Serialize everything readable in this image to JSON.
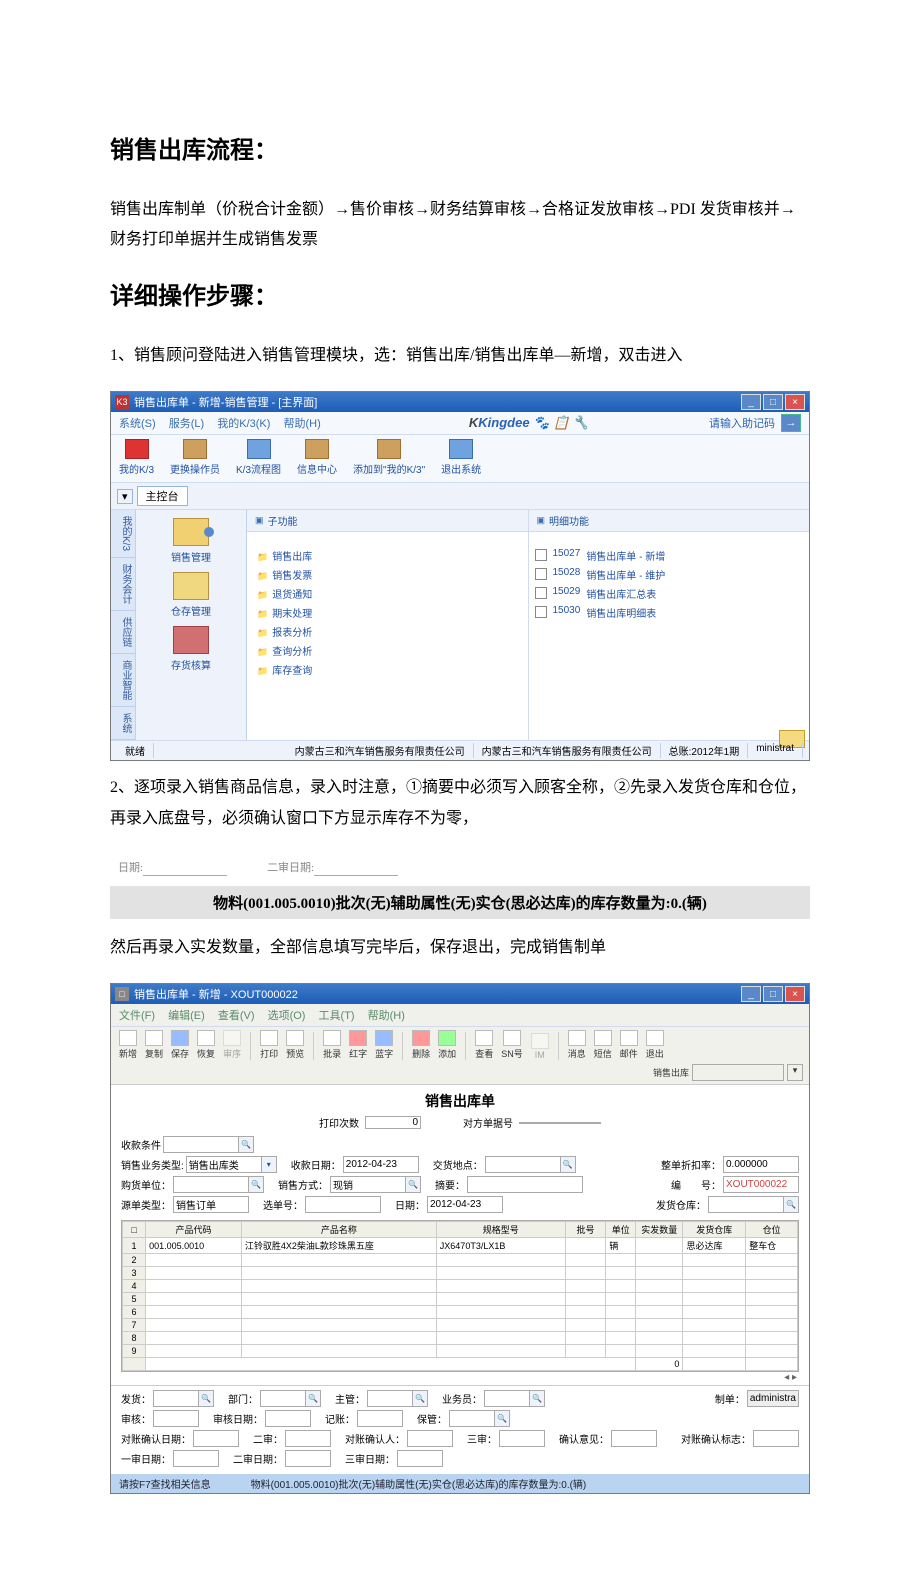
{
  "heading1": "销售出库流程：",
  "para1": "销售出库制单（价税合计金额）→售价审核→财务结算审核→合格证发放审核→PDI 发货审核并→财务打印单据并生成销售发票",
  "heading2": "详细操作步骤：",
  "para2": "1、销售顾问登陆进入销售管理模块，选：销售出库/销售出库单—新增，双击进入",
  "win1": {
    "title": "销售出库单 - 新增-销售管理 - [主界面]",
    "icon": "K3",
    "menu": [
      "系统(S)",
      "服务(L)",
      "我的K/3(K)",
      "帮助(H)"
    ],
    "kingdee": "Kingdee",
    "search_hint": "请输入助记码",
    "tb": [
      {
        "name": "mykc",
        "label": "我的K/3",
        "style": "tb-red"
      },
      {
        "name": "swop",
        "label": "更换操作员",
        "style": "tb-brown"
      },
      {
        "name": "flow",
        "label": "K/3流程图",
        "style": "tb-blue"
      },
      {
        "name": "info",
        "label": "信息中心",
        "style": "tb-brown"
      },
      {
        "name": "addmy",
        "label": "添加到\"我的K/3\"",
        "style": "tb-brown"
      },
      {
        "name": "exit",
        "label": "退出系统",
        "style": "tb-blue"
      }
    ],
    "tab_main": "主控台",
    "mods": [
      {
        "name": "sales",
        "label": "销售管理",
        "ic": "truck"
      },
      {
        "name": "stock",
        "label": "仓存管理",
        "ic": "house"
      },
      {
        "name": "check",
        "label": "存货核算",
        "ic": "stack"
      }
    ],
    "sidetabs": [
      "我的K/3",
      "财务会计",
      "供应链",
      "商业智能",
      "系统"
    ],
    "subfunc_title": "子功能",
    "subfunc": [
      "销售出库",
      "销售发票",
      "退货通知",
      "期末处理",
      "报表分析",
      "查询分析",
      "库存查询"
    ],
    "detail_title": "明细功能",
    "details": [
      {
        "code": "15027",
        "label": "销售出库单 - 新增"
      },
      {
        "code": "15028",
        "label": "销售出库单 - 维护"
      },
      {
        "code": "15029",
        "label": "销售出库汇总表"
      },
      {
        "code": "15030",
        "label": "销售出库明细表"
      }
    ],
    "status_ready": "就绪",
    "status_c1": "内蒙古三和汽车销售服务有限责任公司",
    "status_c2": "内蒙古三和汽车销售服务有限责任公司",
    "status_c3": "总账:2012年1期",
    "status_c4": "ministrat"
  },
  "para3": "2、逐项录入销售商品信息，录入时注意，①摘要中必须写入顾客全称，②先录入发货仓库和仓位，再录入底盘号，必须确认窗口下方显示库存不为零，",
  "greybar": "物料(001.005.0010)批次(无)辅助属性(无)实仓(思必达库)的库存数量为:0.(辆)",
  "para4": "然后再录入实发数量，全部信息填写完毕后，保存退出，完成销售制单",
  "tiny": {
    "l1": "日期:",
    "l2": "二审日期:"
  },
  "win2": {
    "title": "销售出库单 - 新增 - XOUT000022",
    "menu": [
      "文件(F)",
      "编辑(E)",
      "查看(V)",
      "选项(O)",
      "工具(T)",
      "帮助(H)"
    ],
    "tb": [
      "新增",
      "复制",
      "保存",
      "恢复",
      "审序",
      "打印",
      "预览",
      "批录",
      "红字",
      "蓝字",
      "删除",
      "添加",
      "查看",
      "SN号",
      "IM",
      "消息",
      "短信",
      "邮件",
      "退出"
    ],
    "tag": "销售出库",
    "form_title": "销售出库单",
    "print_lbl": "打印次数",
    "print_val": "0",
    "opp_no_lbl": "对方单据号",
    "r0_lbl": "收款条件",
    "r1": {
      "a_lbl": "销售业务类型:",
      "a_val": "销售出库类",
      "b_lbl": "收款日期：",
      "b_val": "2012-04-23",
      "c_lbl": "交货地点：",
      "d_lbl": "整单折扣率：",
      "d_val": "0.000000"
    },
    "r2": {
      "a_lbl": "购货单位：",
      "b_lbl": "销售方式：",
      "b_val": "现销",
      "c_lbl": "摘要：",
      "d_lbl": "编　　号：",
      "d_val": "XOUT000022"
    },
    "r3": {
      "a_lbl": "源单类型：",
      "a_val": "销售订单",
      "b_lbl": "选单号：",
      "c_lbl": "日期：",
      "c_val": "2012-04-23",
      "d_lbl": "发货仓库："
    },
    "grid": {
      "cols": [
        "产品代码",
        "产品名称",
        "规格型号",
        "批号",
        "单位",
        "实发数量",
        "发货仓库",
        "仓位"
      ],
      "row": {
        "code": "001.005.0010",
        "name": "江铃驭胜4X2柴油L款珍珠黑五座",
        "spec": "JX6470T3/LX1B",
        "unit": "辆",
        "wh": "思必达库",
        "pos": "整车仓"
      },
      "sum": "0"
    },
    "bottom": {
      "row1": [
        [
          "发货：",
          ""
        ],
        [
          "部门：",
          ""
        ],
        [
          "主管：",
          ""
        ],
        [
          "业务员：",
          ""
        ],
        [
          "制单：",
          "administra"
        ]
      ],
      "row2": [
        [
          "审核：",
          ""
        ],
        [
          "审核日期：",
          ""
        ],
        [
          "记账：",
          ""
        ],
        [
          "保管：",
          ""
        ]
      ],
      "row3": [
        [
          "对账确认日期：",
          ""
        ],
        [
          "二审：",
          ""
        ],
        [
          "对账确认人：",
          ""
        ],
        [
          "三审：",
          ""
        ],
        [
          "确认意见：",
          ""
        ],
        [
          "对账确认标志：",
          ""
        ]
      ],
      "row4": [
        [
          "一审日期：",
          ""
        ],
        [
          "二审日期：",
          ""
        ],
        [
          "三审日期：",
          ""
        ]
      ]
    },
    "status1": "请按F7查找相关信息",
    "status2": "物料(001.005.0010)批次(无)辅助属性(无)实仓(思必达库)的库存数量为:0.(辆)"
  }
}
